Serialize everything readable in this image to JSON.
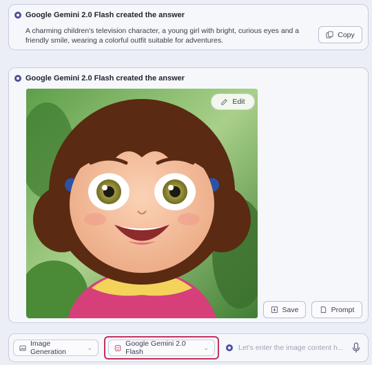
{
  "answer_card": {
    "header": "Google Gemini 2.0 Flash created the answer",
    "text": "A charming children's television character, a young girl with bright, curious eyes and a friendly smile, wearing a colorful outfit suitable for adventures.",
    "copy_label": "Copy"
  },
  "image_card": {
    "header": "Google Gemini 2.0 Flash created the answer",
    "edit_label": "Edit",
    "save_label": "Save",
    "prompt_label": "Prompt"
  },
  "toolbar": {
    "mode_label": "Image Generation",
    "model_label": "Google Gemini 2.0 Flash",
    "input_placeholder": "Let's enter the image content h...",
    "input_value": ""
  },
  "icons": {
    "header_marker": "radio-dot-icon",
    "copy": "copy-icon",
    "edit": "edit-icon",
    "save": "save-icon",
    "prompt": "document-icon",
    "mode": "image-icon",
    "model": "model-icon",
    "dropdown": "chevron-down-icon",
    "mic": "microphone-icon"
  },
  "colors": {
    "accent": "#4b4f9a",
    "highlight_outline": "#c5305a",
    "background": "#eceef6"
  }
}
